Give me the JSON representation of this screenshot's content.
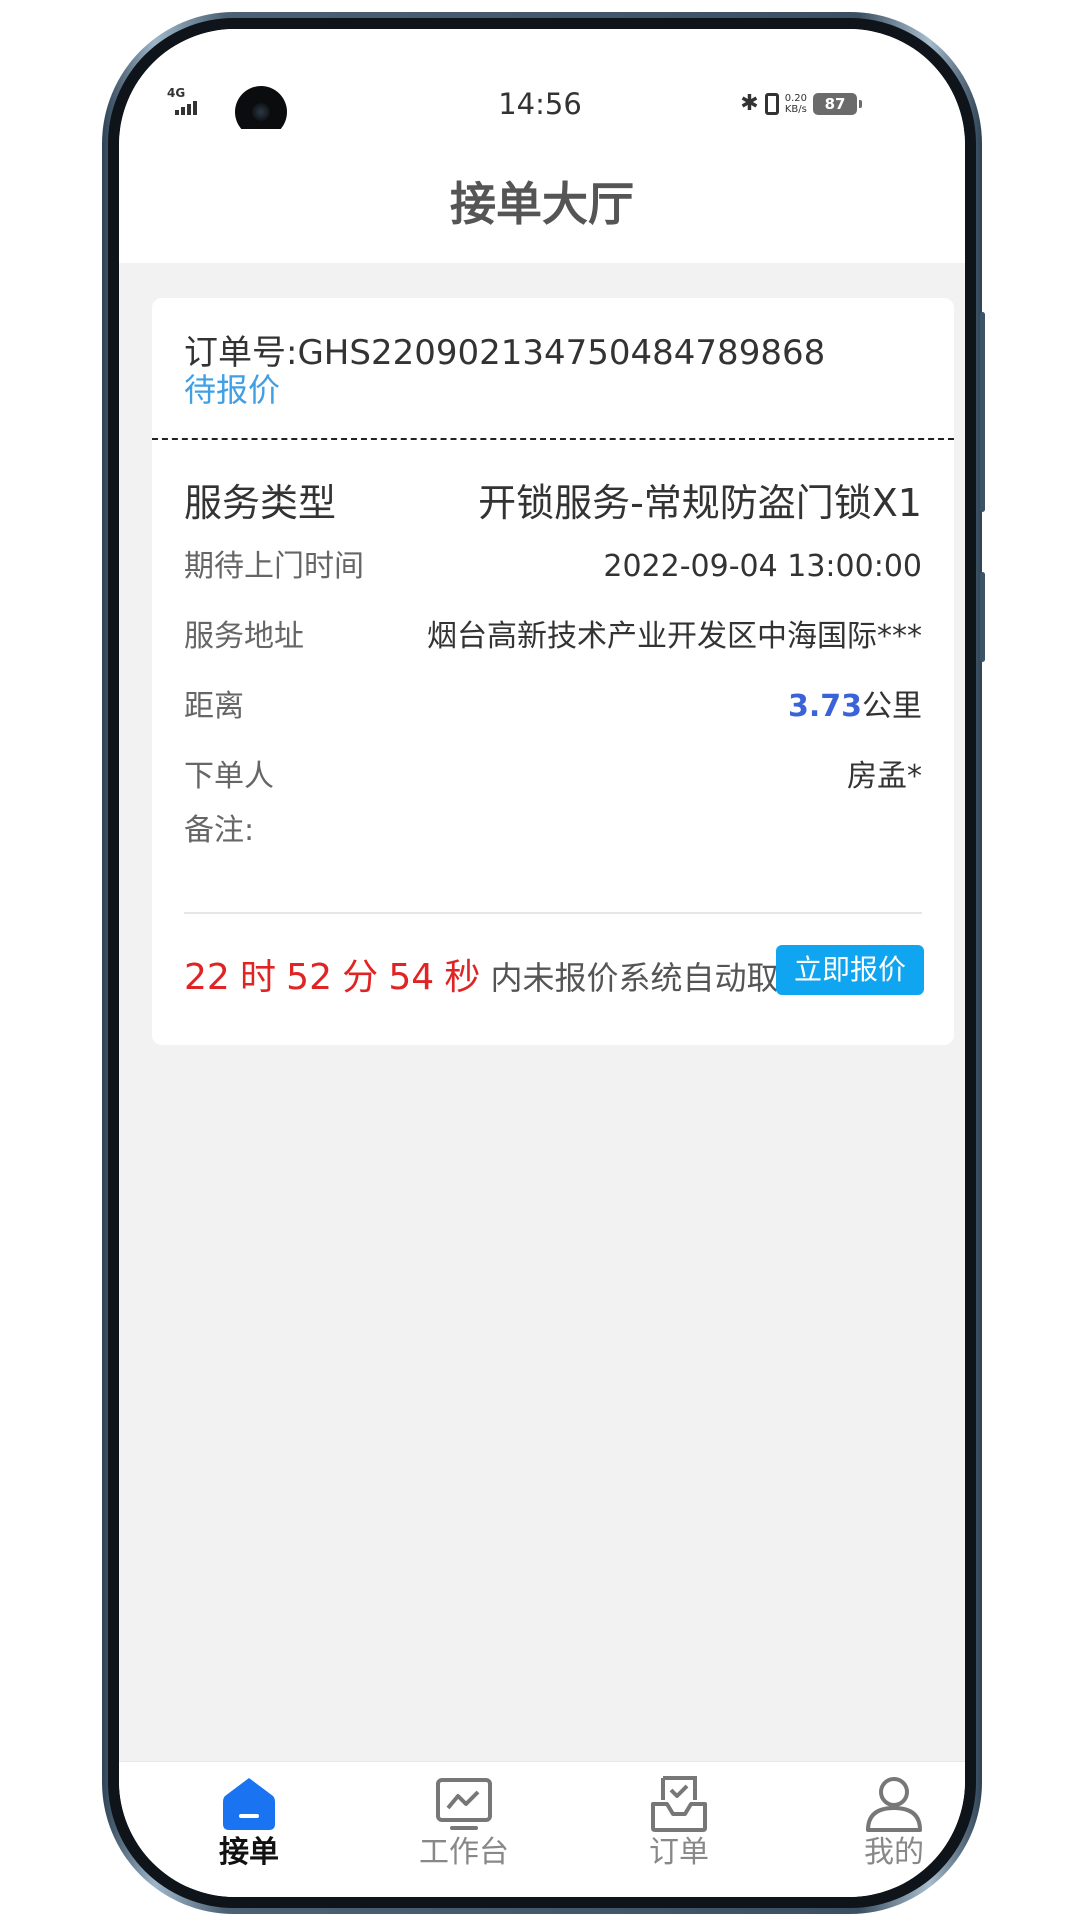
{
  "status_bar": {
    "network": "4G",
    "time": "14:56",
    "speed_value": "0.20",
    "speed_unit": "KB/s",
    "battery": "87"
  },
  "header": {
    "title": "接单大厅"
  },
  "order": {
    "order_no": "订单号:GHS2209021347504847898​68",
    "status": "待报价",
    "service_type_label": "服务类型",
    "service_type_value": "开锁服务-常规防盗门锁X1",
    "expected_time_label": "期待上门时间",
    "expected_time_value": "2022-09-04 13:00:00",
    "address_label": "服务地址",
    "address_value": "烟台高新技术产业开发区中海国际***",
    "distance_label": "距离",
    "distance_value": "3.73",
    "distance_unit": "公里",
    "customer_label": "下单人",
    "customer_value": "房孟*",
    "remark_label": "备注:",
    "countdown": {
      "hours": "22",
      "hours_unit": "时",
      "minutes": "52",
      "minutes_unit": "分",
      "seconds": "54",
      "seconds_unit": "秒",
      "suffix": "内未报价系统自动取消"
    },
    "quote_button": "立即报价"
  },
  "tabbar": {
    "active": "orders-hall",
    "items": [
      {
        "label": "接单",
        "icon": "home-icon"
      },
      {
        "label": "工作台",
        "icon": "monitor-chart-icon"
      },
      {
        "label": "订单",
        "icon": "inbox-check-icon"
      },
      {
        "label": "我的",
        "icon": "user-icon"
      }
    ]
  },
  "colors": {
    "accent_blue": "#10a5f0",
    "status_blue": "#3fa0e6",
    "distance_blue": "#3a63d8",
    "countdown_red": "#e02424",
    "tab_active_icon": "#1a73f0"
  }
}
